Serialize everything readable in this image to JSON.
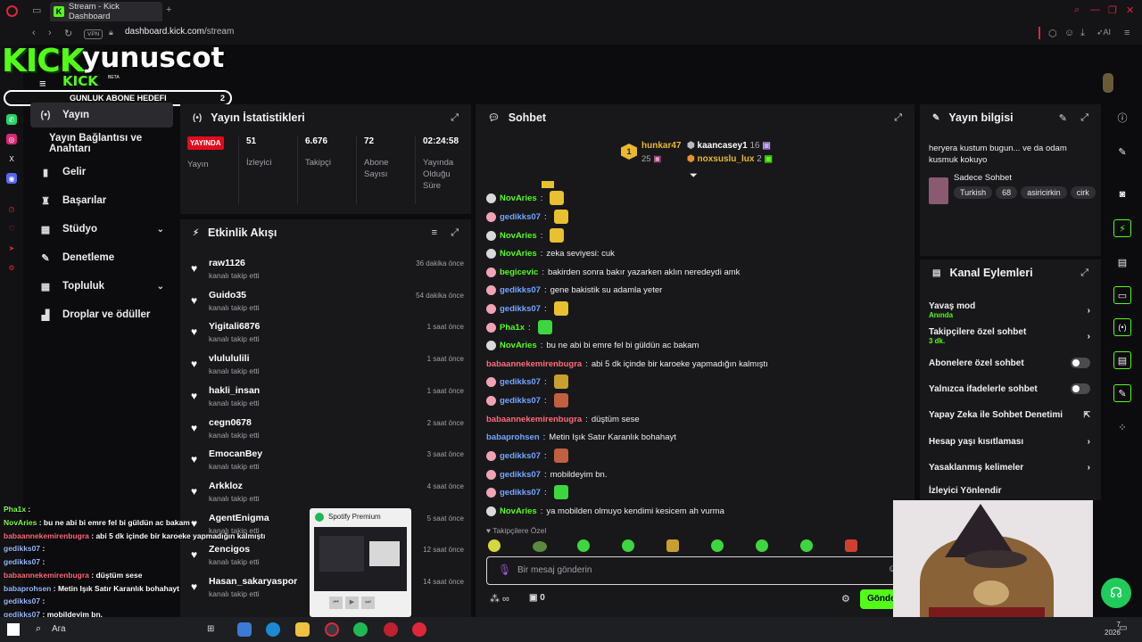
{
  "browser": {
    "tab_title": "Stream - Kick Dashboard",
    "url_domain": "dashboard.kick.com",
    "url_path": "/stream",
    "vpn_label": "VPN",
    "ai_label": "AI"
  },
  "overlay": {
    "logo": "KICK",
    "streamer": "yunuscot",
    "small_logo": "KICK",
    "beta": "BETA",
    "goal_label": "GUNLUK ABONE HEDEFI",
    "goal_value": "2"
  },
  "nav": [
    {
      "icon": "(•)",
      "label": "Yayın"
    },
    {
      "icon": "",
      "label": "Yayın Bağlantısı ve Anahtarı"
    },
    {
      "icon": "▮",
      "label": "Gelir"
    },
    {
      "icon": "♜",
      "label": "Başarılar"
    },
    {
      "icon": "▦",
      "label": "Stüdyo"
    },
    {
      "icon": "✎",
      "label": "Denetleme"
    },
    {
      "icon": "▦",
      "label": "Topluluk"
    },
    {
      "icon": "▟",
      "label": "Droplar ve ödüller"
    }
  ],
  "stats": {
    "title": "Yayın İstatistikleri",
    "live_badge": "YAYINDA",
    "items": [
      {
        "value": "",
        "label": "Yayın"
      },
      {
        "value": "51",
        "label": "İzleyici"
      },
      {
        "value": "6.676",
        "label": "Takipçi"
      },
      {
        "value": "72",
        "label": "Abone Sayısı"
      },
      {
        "value": "02:24:58",
        "label": "Yayında Olduğu Süre"
      }
    ]
  },
  "events": {
    "title": "Etkinlik Akışı",
    "items": [
      {
        "name": "raw1126",
        "sub": "kanalı takip etti",
        "time": "36 dakika önce"
      },
      {
        "name": "Guido35",
        "sub": "kanalı takip etti",
        "time": "54 dakika önce"
      },
      {
        "name": "Yigitali6876",
        "sub": "kanalı takip etti",
        "time": "1 saat önce"
      },
      {
        "name": "vlulululili",
        "sub": "kanalı takip etti",
        "time": "1 saat önce"
      },
      {
        "name": "hakli_insan",
        "sub": "kanalı takip etti",
        "time": "1 saat önce"
      },
      {
        "name": "cegn0678",
        "sub": "kanalı takip etti",
        "time": "2 saat önce"
      },
      {
        "name": "EmocanBey",
        "sub": "kanalı takip etti",
        "time": "3 saat önce"
      },
      {
        "name": "Arkkloz",
        "sub": "kanalı takip etti",
        "time": "4 saat önce"
      },
      {
        "name": "AgentEnigma",
        "sub": "kanalı takip etti",
        "time": "5 saat önce"
      },
      {
        "name": "Zencigos",
        "sub": "kanalı takip etti",
        "time": "12 saat önce"
      },
      {
        "name": "Hasan_sakaryaspor",
        "sub": "kanalı takip etti",
        "time": "14 saat önce"
      }
    ]
  },
  "chat": {
    "title": "Sohbet",
    "top_gifters": [
      {
        "rank": "1",
        "name": "hunkar47",
        "count": "25"
      },
      {
        "name": "kaancasey1",
        "count": "16"
      },
      {
        "name": "noxsuslu_lux",
        "count": "2"
      }
    ],
    "messages": [
      {
        "user": "NovAries",
        "text": "",
        "color": "#53fc18",
        "badge": "w",
        "emote": "#e8c030"
      },
      {
        "user": "gedikks07",
        "text": "",
        "color": "#72a6ff",
        "badge": "p",
        "emote": "#e8c030"
      },
      {
        "user": "NovAries",
        "text": "",
        "color": "#53fc18",
        "badge": "w",
        "emote": "#e8c030"
      },
      {
        "user": "NovAries",
        "text": "zeka seviyesi: cuk",
        "color": "#53fc18",
        "badge": "w",
        "emote": ""
      },
      {
        "user": "begicevic",
        "text": "bakirden sonra bakır yazarken aklın neredeydi amk",
        "color": "#53fc18",
        "badge": "p",
        "emote": ""
      },
      {
        "user": "gedikks07",
        "text": "gene bakistik su adamla yeter",
        "color": "#72a6ff",
        "badge": "p",
        "emote": ""
      },
      {
        "user": "gedikks07",
        "text": "",
        "color": "#72a6ff",
        "badge": "p",
        "emote": "#e8c030"
      },
      {
        "user": "Pha1x",
        "text": "",
        "color": "#53fc18",
        "badge": "p",
        "emote": "#3ed63e"
      },
      {
        "user": "NovAries",
        "text": "bu ne abi bi emre fel bi güldün ac bakam",
        "color": "#53fc18",
        "badge": "w",
        "emote": ""
      },
      {
        "user": "babaannekemirenbugra",
        "text": "abi 5 dk içinde bir karoeke yapmadığın kalmıştı",
        "color": "#ff6b7a",
        "badge": "",
        "emote": ""
      },
      {
        "user": "gedikks07",
        "text": "",
        "color": "#72a6ff",
        "badge": "p",
        "emote": "#c8a030"
      },
      {
        "user": "gedikks07",
        "text": "",
        "color": "#72a6ff",
        "badge": "p",
        "emote": "#c06040"
      },
      {
        "user": "babaannekemirenbugra",
        "text": "düştüm sese",
        "color": "#ff6b7a",
        "badge": "",
        "emote": ""
      },
      {
        "user": "babaprohsen",
        "text": "Metin Işık Satır Karanlık bohahayt",
        "color": "#72a6ff",
        "badge": "",
        "emote": ""
      },
      {
        "user": "gedikks07",
        "text": "",
        "color": "#72a6ff",
        "badge": "p",
        "emote": "#c06040"
      },
      {
        "user": "gedikks07",
        "text": "mobildeyim bn.",
        "color": "#72a6ff",
        "badge": "p",
        "emote": ""
      },
      {
        "user": "gedikks07",
        "text": "",
        "color": "#72a6ff",
        "badge": "p",
        "emote": "#3ed63e"
      },
      {
        "user": "NovAries",
        "text": "ya mobilden olmuyo kendimi kesicem ah vurma",
        "color": "#53fc18",
        "badge": "w",
        "emote": ""
      }
    ],
    "followers_only": "Takipçilere Özel",
    "placeholder": "Bir mesaj gönderin",
    "kicks_count": "0",
    "send_label": "Gönder"
  },
  "stream_info": {
    "title": "Yayın bilgisi",
    "stream_title": "heryera kustum bugun... ve da odam kusmuk kokuyo",
    "category": "Sadece Sohbet",
    "tags": [
      "Turkish",
      "68",
      "asiricirkin",
      "cirk"
    ]
  },
  "channel_actions": {
    "title": "Kanal Eylemleri",
    "items": [
      {
        "label": "Yavaş mod",
        "sub": "Anında",
        "control": "chevron"
      },
      {
        "label": "Takipçilere özel sohbet",
        "sub": "3 dk.",
        "control": "chevron"
      },
      {
        "label": "Abonelere özel sohbet",
        "sub": "",
        "control": "toggle"
      },
      {
        "label": "Yalnızca ifadelerle sohbet",
        "sub": "",
        "control": "toggle"
      },
      {
        "label": "Yapay Zeka ile Sohbet Denetimi",
        "sub": "",
        "control": "external"
      },
      {
        "label": "Hesap yaşı kısıtlaması",
        "sub": "",
        "control": "chevron"
      },
      {
        "label": "Yasaklanmış kelimeler",
        "sub": "",
        "control": "chevron"
      },
      {
        "label": "İzleyici Yönlendir",
        "sub": "",
        "control": ""
      }
    ]
  },
  "spotify": {
    "label": "Spotify Premium"
  },
  "overlay_chat": [
    {
      "user": "Pha1x",
      "text": ""
    },
    {
      "user": "NovAries",
      "text": "bu ne abi bi emre fel bi güldün ac bakam"
    },
    {
      "user": "babaannekemirenbugra",
      "text": "abi 5 dk içinde bir karoeke yapmadığın kalmıştı"
    },
    {
      "user": "gedikks07",
      "text": ""
    },
    {
      "user": "gedikks07",
      "text": ""
    },
    {
      "user": "babaannekemirenbugra",
      "text": "düştüm sese"
    },
    {
      "user": "babaprohsen",
      "text": "Metin Işık Satır Karanlık bohahayt"
    },
    {
      "user": "gedikks07",
      "text": ""
    },
    {
      "user": "gedikks07",
      "text": "mobildeyim bn."
    }
  ],
  "taskbar": {
    "search": "Ara",
    "clock_1": "7",
    "clock_2": "2026"
  }
}
